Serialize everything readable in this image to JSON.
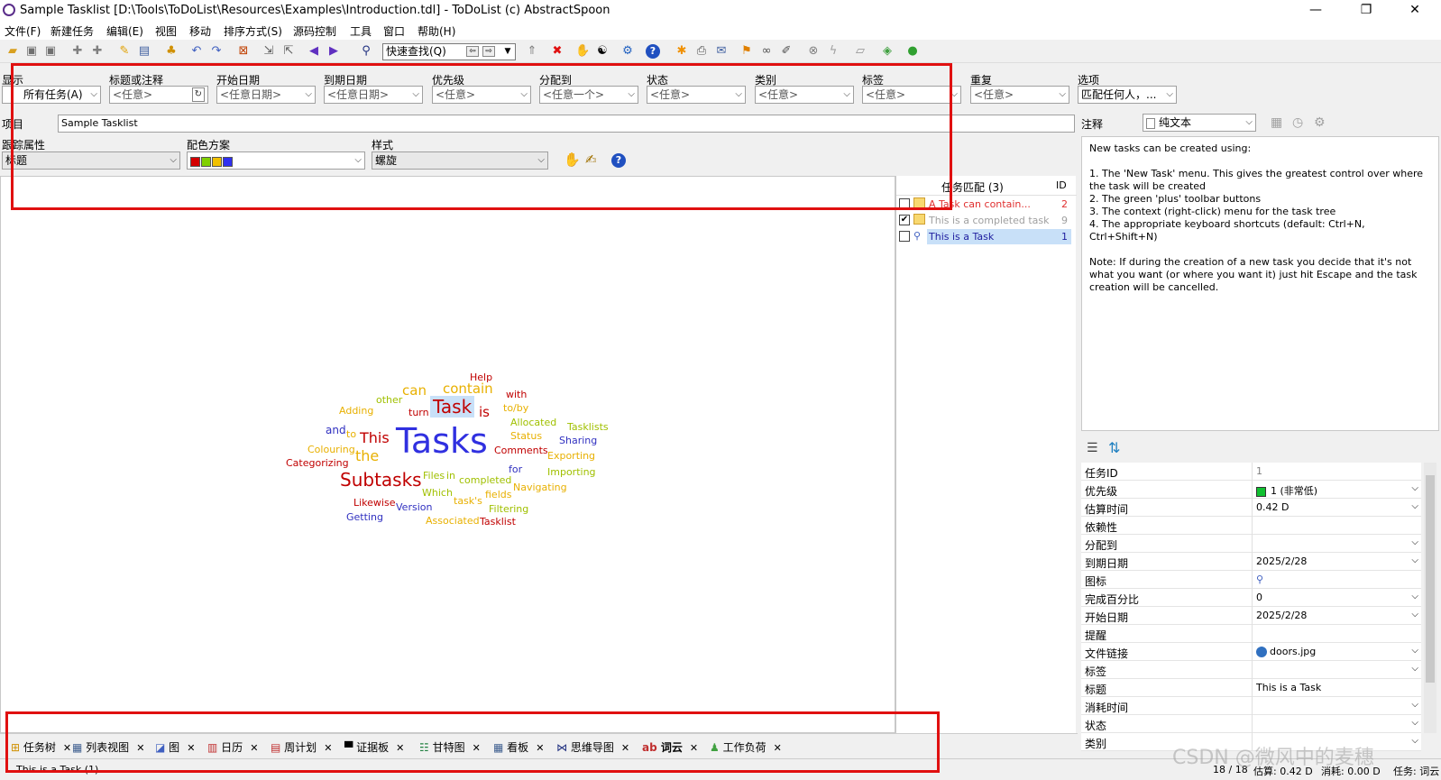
{
  "window": {
    "title": "Sample Tasklist [D:\\Tools\\ToDoList\\Resources\\Examples\\Introduction.tdl] - ToDoList (c) AbstractSpoon",
    "min": "—",
    "restore": "❐",
    "close": "✕"
  },
  "menu": [
    "文件(F)",
    "新建任务",
    "编辑(E)",
    "视图",
    "移动",
    "排序方式(S)",
    "源码控制",
    "工具",
    "窗口",
    "帮助(H)"
  ],
  "toolbar": {
    "quickfind_placeholder": "快速查找(Q)"
  },
  "filters": [
    {
      "label": "显示",
      "value": "所有任务(A)"
    },
    {
      "label": "标题或注释",
      "value": "<任意>"
    },
    {
      "label": "开始日期",
      "value": "<任意日期>"
    },
    {
      "label": "到期日期",
      "value": "<任意日期>"
    },
    {
      "label": "优先级",
      "value": "<任意>"
    },
    {
      "label": "分配到",
      "value": "<任意一个>"
    },
    {
      "label": "状态",
      "value": "<任意>"
    },
    {
      "label": "类别",
      "value": "<任意>"
    },
    {
      "label": "标签",
      "value": "<任意>"
    },
    {
      "label": "重复",
      "value": "<任意>"
    },
    {
      "label": "选项",
      "value": "匹配任何人，..."
    }
  ],
  "project": {
    "label": "项目",
    "value": "Sample Tasklist"
  },
  "tracking": {
    "attr_label": "跟踪属性",
    "attr_value": "标题",
    "scheme_label": "配色方案",
    "scheme_colors": [
      "#d40000",
      "#80d000",
      "#f0c000",
      "#3030f0"
    ],
    "style_label": "样式",
    "style_value": "螺旋"
  },
  "matches": {
    "header": "任务匹配 (3)",
    "id_header": "ID",
    "rows": [
      {
        "title": "A Task can contain...",
        "id": "2",
        "checked": false,
        "color": "#e03030"
      },
      {
        "title": "This is a completed task",
        "id": "9",
        "checked": true,
        "color": "#a0a0a0"
      },
      {
        "title": "This is a Task",
        "id": "1",
        "checked": false,
        "color": "#2020a0",
        "selected": true
      }
    ]
  },
  "wordcloud": [
    {
      "text": "Help",
      "color": "#c00000"
    },
    {
      "text": "can",
      "color": "#e8b000"
    },
    {
      "text": "contain",
      "color": "#e8b000"
    },
    {
      "text": "with",
      "color": "#c00000"
    },
    {
      "text": "other",
      "color": "#a0c000"
    },
    {
      "text": "to/by",
      "color": "#e8b000"
    },
    {
      "text": "Adding",
      "color": "#e8b000"
    },
    {
      "text": "turn",
      "color": "#c00000"
    },
    {
      "text": "Task",
      "color": "#c00000"
    },
    {
      "text": "is",
      "color": "#c00000"
    },
    {
      "text": "Allocated",
      "color": "#a0c000"
    },
    {
      "text": "Tasklists",
      "color": "#a0c000"
    },
    {
      "text": "and",
      "color": "#3030c0"
    },
    {
      "text": "to",
      "color": "#e8b000"
    },
    {
      "text": "This",
      "color": "#c00000"
    },
    {
      "text": "Tasks",
      "color": "#3030e0"
    },
    {
      "text": "Status",
      "color": "#e8b000"
    },
    {
      "text": "Sharing",
      "color": "#3030c0"
    },
    {
      "text": "Colouring",
      "color": "#e8b000"
    },
    {
      "text": "the",
      "color": "#e8b000"
    },
    {
      "text": "Comments",
      "color": "#c00000"
    },
    {
      "text": "Exporting",
      "color": "#e8b000"
    },
    {
      "text": "Categorizing",
      "color": "#c00000"
    },
    {
      "text": "for",
      "color": "#3030c0"
    },
    {
      "text": "Subtasks",
      "color": "#c00000"
    },
    {
      "text": "Files",
      "color": "#a0c000"
    },
    {
      "text": "in",
      "color": "#a0c000"
    },
    {
      "text": "completed",
      "color": "#a0c000"
    },
    {
      "text": "Importing",
      "color": "#a0c000"
    },
    {
      "text": "Which",
      "color": "#a0c000"
    },
    {
      "text": "fields",
      "color": "#e8b000"
    },
    {
      "text": "Navigating",
      "color": "#e8b000"
    },
    {
      "text": "Likewise",
      "color": "#c00000"
    },
    {
      "text": "task's",
      "color": "#e8b000"
    },
    {
      "text": "Version",
      "color": "#3030c0"
    },
    {
      "text": "Filtering",
      "color": "#a0c000"
    },
    {
      "text": "Getting",
      "color": "#3030c0"
    },
    {
      "text": "Associated",
      "color": "#e8b000"
    },
    {
      "text": "Tasklist",
      "color": "#c00000"
    }
  ],
  "notes": {
    "label": "注释",
    "format": "纯文本",
    "lines": [
      "New tasks can be created using:",
      "",
      "1. The 'New Task' menu. This gives the greatest control over where the task will be created",
      "2. The green 'plus' toolbar buttons",
      "3. The context (right-click) menu for the task tree",
      "4. The appropriate keyboard shortcuts (default: Ctrl+N, Ctrl+Shift+N)",
      "",
      "Note: If during the creation of a new task you decide that it's not what you want (or where you want it) just hit Escape and the task creation will be cancelled."
    ]
  },
  "properties": [
    {
      "name": "任务ID",
      "value": "1"
    },
    {
      "name": "优先级",
      "value": "1 (非常低)"
    },
    {
      "name": "估算时间",
      "value": "0.42 D"
    },
    {
      "name": "依赖性",
      "value": ""
    },
    {
      "name": "分配到",
      "value": ""
    },
    {
      "name": "到期日期",
      "value": "2025/2/28"
    },
    {
      "name": "图标",
      "value": ""
    },
    {
      "name": "完成百分比",
      "value": "0"
    },
    {
      "name": "开始日期",
      "value": "2025/2/28"
    },
    {
      "name": "提醒",
      "value": ""
    },
    {
      "name": "文件链接",
      "value": "doors.jpg"
    },
    {
      "name": "标签",
      "value": ""
    },
    {
      "name": "标题",
      "value": "This is a Task"
    },
    {
      "name": "消耗时间",
      "value": ""
    },
    {
      "name": "状态",
      "value": ""
    },
    {
      "name": "类别",
      "value": ""
    }
  ],
  "view_tabs": [
    "任务树",
    "列表视图",
    "图",
    "日历",
    "周计划",
    "证据板",
    "甘特图",
    "看板",
    "思维导图",
    "词云",
    "工作负荷"
  ],
  "status": {
    "left": "This is a Task (1)",
    "count": "18 / 18",
    "est": "估算: 0.42 D",
    "spent": "消耗: 0.00 D",
    "task": "任务: 词云"
  },
  "watermark": "CSDN @微风中的麦穗",
  "colors": {
    "highlight": "#e01010",
    "selection": "#c8e0f8",
    "accent": "#0066cc"
  }
}
